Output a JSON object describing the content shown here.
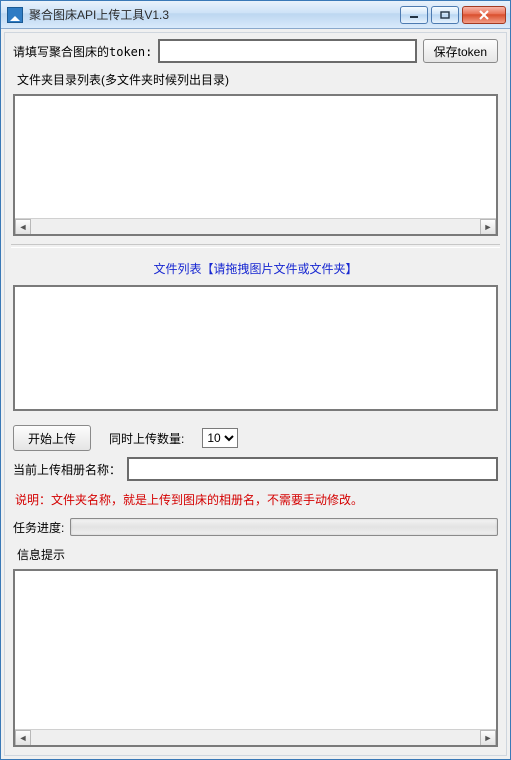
{
  "window": {
    "title": "聚合图床API上传工具V1.3"
  },
  "token_row": {
    "label": "请填写聚合图床的token:",
    "value": "",
    "save_label": "保存token"
  },
  "folder_group": {
    "label": "文件夹目录列表(多文件夹时候列出目录)"
  },
  "file_group": {
    "label": "文件列表【请拖拽图片文件或文件夹】"
  },
  "upload": {
    "start_label": "开始上传",
    "concurrent_label": "同时上传数量:",
    "concurrent_value": "10"
  },
  "album": {
    "label": "当前上传相册名称：",
    "value": ""
  },
  "note": {
    "text": "说明：文件夹名称，就是上传到图床的相册名，不需要手动修改。"
  },
  "progress": {
    "label": "任务进度:"
  },
  "log": {
    "label": "信息提示"
  }
}
